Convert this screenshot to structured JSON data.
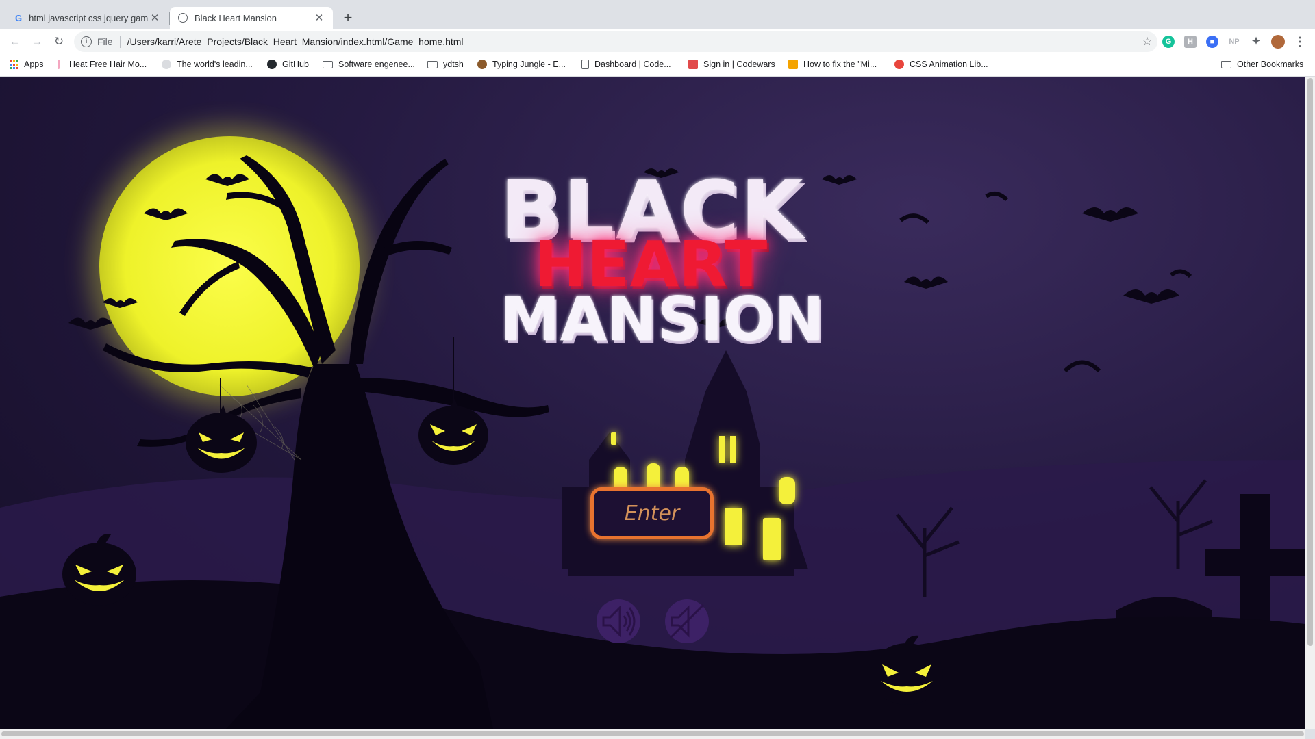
{
  "tabs": [
    {
      "title": "html javascript css jquery gam",
      "favicon": "google-g-icon",
      "active": false
    },
    {
      "title": "Black Heart Mansion",
      "favicon": "globe-icon",
      "active": true
    }
  ],
  "new_tab_label": "+",
  "close_glyph": "✕",
  "toolbar": {
    "back": "←",
    "forward": "→",
    "reload": "↻",
    "info_glyph": "i",
    "scheme": "File",
    "url": "/Users/karri/Arete_Projects/Black_Heart_Mansion/index.html/Game_home.html",
    "star": "☆",
    "extensions": [
      {
        "name": "grammarly-icon",
        "label": "G",
        "color": "#15c39a"
      },
      {
        "name": "extension-h-icon",
        "label": "H",
        "color": "#b0b3b8"
      },
      {
        "name": "extension-blue-icon",
        "label": "■",
        "color": "#3b6ff5"
      },
      {
        "name": "extension-np-icon",
        "label": "NP",
        "color": "#b0b3b8"
      },
      {
        "name": "puzzle-icon",
        "label": "✦",
        "color": "#5f6368"
      },
      {
        "name": "avatar-icon",
        "label": "",
        "color": "#b0683a"
      }
    ],
    "menu": "⋮"
  },
  "bookmarks": [
    {
      "label": "Apps",
      "icon": "apps-grid-icon",
      "color": "#e8453c"
    },
    {
      "label": "Heat Free Hair Mo...",
      "icon": "bookmark-pink-icon",
      "color": "#f4a7c0"
    },
    {
      "label": "The world's leadin...",
      "icon": "github-icon-light",
      "color": "#dadce0"
    },
    {
      "label": "GitHub",
      "icon": "github-icon",
      "color": "#24292e"
    },
    {
      "label": "Software engenee...",
      "icon": "folder-icon",
      "color": ""
    },
    {
      "label": "ydtsh",
      "icon": "folder-icon",
      "color": ""
    },
    {
      "label": "Typing Jungle - E...",
      "icon": "monkey-icon",
      "color": "#8b5a2b"
    },
    {
      "label": "Dashboard | Code...",
      "icon": "document-icon",
      "color": "#5f6368"
    },
    {
      "label": "Sign in | Codewars",
      "icon": "codewars-icon",
      "color": "#e14a4a"
    },
    {
      "label": "How to fix the \"Mi...",
      "icon": "stackoverflow-icon",
      "color": "#f4a300"
    },
    {
      "label": "CSS Animation Lib...",
      "icon": "animation-icon",
      "color": "#e8453c"
    }
  ],
  "other_bookmarks": "Other Bookmarks",
  "game": {
    "title_line1": "BLACK",
    "title_line2": "HEART",
    "title_line3": "MANSION",
    "enter_label": "Enter",
    "sound_on_icon": "speaker-on-icon",
    "sound_off_icon": "speaker-mute-icon"
  },
  "colors": {
    "moon": "#f2f52a",
    "window_glow": "#f4f03a",
    "title_red": "#ef1a33",
    "enter_border": "#e8732f",
    "sound_button": "#3d2166"
  }
}
